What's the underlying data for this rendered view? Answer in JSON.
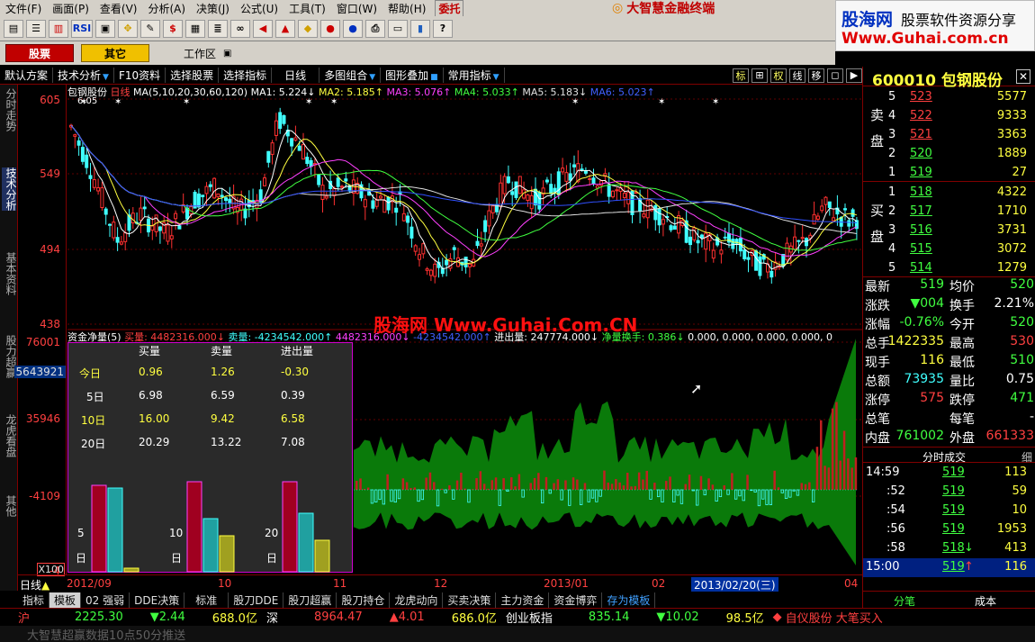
{
  "menu": {
    "items": [
      "文件(F)",
      "画面(P)",
      "查看(V)",
      "分析(A)",
      "决策(J)",
      "公式(U)",
      "工具(T)",
      "窗口(W)",
      "帮助(H)"
    ],
    "trust": "委托"
  },
  "brand": {
    "title": "大智慧金融终端",
    "logo_line1": "股海网",
    "logo_line1b": "股票软件资源分享",
    "logo_line2": "Www.Guhai.com.cn"
  },
  "toolbar": {
    "icons": [
      "file-icon",
      "list-icon",
      "chart-icon",
      "RSI",
      "window-icon",
      "move-icon",
      "ruler-icon",
      "dollar-icon",
      "grid-icon",
      "stack-icon",
      "binoculars-icon",
      "horn-icon",
      "chart-red-icon",
      "diamond-icon",
      "phone-icon",
      "phone2-icon",
      "print-icon",
      "calc-icon",
      "books-icon",
      "help-icon"
    ]
  },
  "tabs": {
    "stock": "股票",
    "other": "其它",
    "workspace": "工作区"
  },
  "funcbar": {
    "items": [
      "默认方案",
      "技术分析",
      "F10资料",
      "选择股票",
      "选择指标",
      "日线",
      "多图组合",
      "图形叠加",
      "常用指标"
    ],
    "icons": [
      "标",
      "⊞",
      "权",
      "线",
      "移"
    ]
  },
  "side_tabs": [
    "分时走势",
    "技术分析",
    "基本资料",
    "股力超赢",
    "龙虎看盘",
    "其他"
  ],
  "price_header": {
    "name": "包钢股份",
    "period": "日线",
    "ma_label": "MA(5,10,20,30,60,120)",
    "ma1": "MA1: 5.224↓",
    "ma2": "MA2: 5.185↑",
    "ma3": "MA3: 5.076↑",
    "ma4": "MA4: 5.033↑",
    "ma5": "MA5: 5.183↓",
    "ma6": "MA6: 5.023↑",
    "hi_mark": "6.05"
  },
  "price_axis": {
    "labels": [
      "605",
      "549",
      "494",
      "438"
    ]
  },
  "flow_header": {
    "title": "资金净量(5)",
    "buy": "买量: 4482316.000↓",
    "sell": "卖量: -4234542.000↑",
    "v1": "4482316.000↓",
    "v2": "-4234542.000↑",
    "inout": "进出量: 247774.000↓",
    "turn": "净量换手: 0.386↓",
    "tail": "0.000, 0.000, 0.000, 0.000, 0"
  },
  "flow_axis": {
    "labels": [
      "76001",
      "5643921",
      "35946",
      "-4109",
      "-4",
      "X100"
    ]
  },
  "watermark": "股海网 Www.Guhai.Com.CN",
  "overlay": {
    "headers": [
      "买量",
      "卖量",
      "进出量"
    ],
    "rows": [
      {
        "label": "今日",
        "buy": "0.96",
        "sell": "1.26",
        "net": "-0.30"
      },
      {
        "label": "5日",
        "buy": "6.98",
        "sell": "6.59",
        "net": "0.39"
      },
      {
        "label": "10日",
        "buy": "16.00",
        "sell": "9.42",
        "net": "6.58"
      },
      {
        "label": "20日",
        "buy": "20.29",
        "sell": "13.22",
        "net": "7.08"
      }
    ],
    "groups": [
      {
        "n": "5",
        "d": "日",
        "bars": [
          0.96,
          0.93,
          0.04
        ]
      },
      {
        "n": "10",
        "d": "日",
        "bars": [
          1.0,
          0.59,
          0.4
        ]
      },
      {
        "n": "20",
        "d": "日",
        "bars": [
          1.0,
          0.65,
          0.35
        ]
      }
    ]
  },
  "x_axis": {
    "period": "日线",
    "date": "2012/09",
    "m10": "10",
    "m11": "11",
    "m12": "12",
    "y2013": "2013/01",
    "m02": "02",
    "cur_date": "2013/02/20(三)",
    "m04": "04"
  },
  "ind_tabs": [
    "指标",
    "模板",
    "02 强弱",
    "DDE决策",
    "标准",
    "股刀DDE",
    "股刀超赢",
    "股刀持仓",
    "龙虎动向",
    "买卖决策",
    "主力资金",
    "资金博弈",
    "存为模板"
  ],
  "status": {
    "sh_label": "沪",
    "sh_index": "2225.30",
    "sh_chg": "▼2.44",
    "sh_amt": "688.0亿",
    "sz_label": "深",
    "sz_index": "8964.47",
    "sz_chg": "▲4.01",
    "sz_amt": "686.0亿",
    "cy_label": "创业板指",
    "cy_index": "835.14",
    "cy_chg": "▼10.02",
    "cy_amt": "98.5亿",
    "alert": "自仪股份 大笔买入",
    "line2": "大智慧超赢数据10点50分推送"
  },
  "rp": {
    "code": "600010",
    "name": "包钢股份",
    "sell_label": "卖盘",
    "buy_label": "买盘",
    "asks": [
      {
        "lv": "5",
        "p": "523",
        "v": "5577"
      },
      {
        "lv": "4",
        "p": "522",
        "v": "9333"
      },
      {
        "lv": "3",
        "p": "521",
        "v": "3363"
      },
      {
        "lv": "2",
        "p": "520",
        "v": "1889"
      },
      {
        "lv": "1",
        "p": "519",
        "v": "27"
      }
    ],
    "bids": [
      {
        "lv": "1",
        "p": "518",
        "v": "4322"
      },
      {
        "lv": "2",
        "p": "517",
        "v": "1710"
      },
      {
        "lv": "3",
        "p": "516",
        "v": "3731"
      },
      {
        "lv": "4",
        "p": "515",
        "v": "3072"
      },
      {
        "lv": "5",
        "p": "514",
        "v": "1279"
      }
    ],
    "quotes": [
      {
        "k1": "最新",
        "v1": "519",
        "c1": "#40ff40",
        "k2": "均价",
        "v2": "520",
        "c2": "#40ff40"
      },
      {
        "k1": "涨跌",
        "v1": "▼004",
        "c1": "#40ff40",
        "k2": "换手",
        "v2": "2.21%",
        "c2": "#ffffff"
      },
      {
        "k1": "涨幅",
        "v1": "-0.76%",
        "c1": "#40ff40",
        "k2": "今开",
        "v2": "520",
        "c2": "#40ff40"
      },
      {
        "k1": "总手",
        "v1": "1422335",
        "c1": "#ffff40",
        "k2": "最高",
        "v2": "530",
        "c2": "#ff4040"
      },
      {
        "k1": "现手",
        "v1": "116",
        "c1": "#ffff40",
        "k2": "最低",
        "v2": "510",
        "c2": "#40ff40"
      },
      {
        "k1": "总额",
        "v1": "73935",
        "c1": "#40ffff",
        "k2": "量比",
        "v2": "0.75",
        "c2": "#ffffff"
      },
      {
        "k1": "涨停",
        "v1": "575",
        "c1": "#ff4040",
        "k2": "跌停",
        "v2": "471",
        "c2": "#40ff40"
      },
      {
        "k1": "总笔",
        "v1": "",
        "c1": "#ffffff",
        "k2": "每笔",
        "v2": "-",
        "c2": "#ffffff"
      },
      {
        "k1": "内盘",
        "v1": "761002",
        "c1": "#40ff40",
        "k2": "外盘",
        "v2": "661333",
        "c2": "#ff4040"
      }
    ],
    "ts_header": "分时成交",
    "ts_detail": "细",
    "ticks": [
      {
        "t": "14:59",
        "p": "519",
        "v": "113",
        "a": ""
      },
      {
        "t": ":52",
        "p": "519",
        "v": "59",
        "a": ""
      },
      {
        "t": ":54",
        "p": "519",
        "v": "10",
        "a": ""
      },
      {
        "t": ":56",
        "p": "519",
        "v": "1953",
        "a": ""
      },
      {
        "t": ":58",
        "p": "518",
        "v": "413",
        "a": "↓"
      },
      {
        "t": "15:00",
        "p": "519",
        "v": "116",
        "a": "↑"
      }
    ],
    "bottom_tabs": [
      "分笔",
      "成本"
    ]
  },
  "colors": {
    "up": "#ff3030",
    "down": "#40ffff",
    "green": "#40ff40",
    "yellow": "#ffff40",
    "axis": "#800000"
  }
}
